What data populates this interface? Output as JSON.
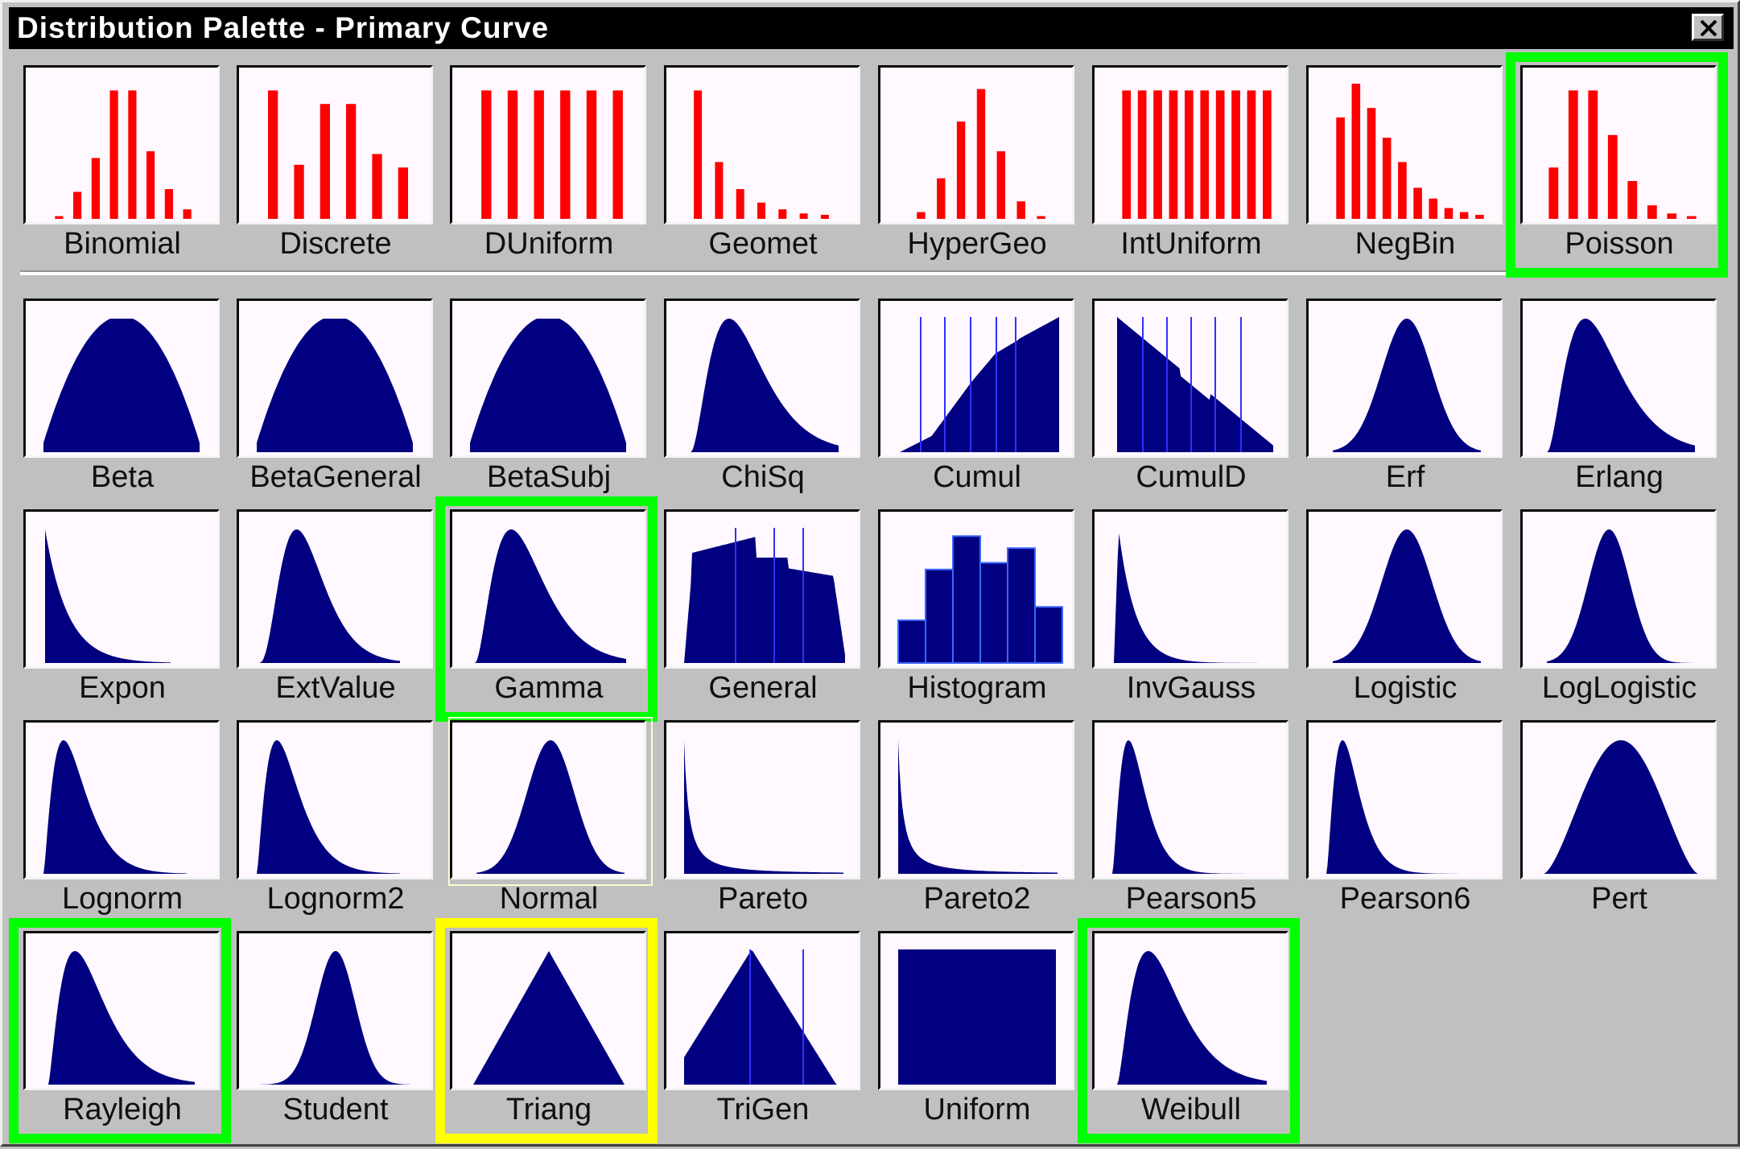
{
  "window": {
    "title": "Distribution Palette - Primary Curve",
    "close_icon": "close-icon"
  },
  "colors": {
    "discrete_bars": "#ff0000",
    "continuous_fill": "#000080",
    "tile_bg": "#fff8ff",
    "highlight_green": "#00ff00",
    "highlight_yellow": "#ffff00"
  },
  "rows": [
    {
      "kind": "discrete",
      "items": [
        {
          "label": "Binomial",
          "shape": "binomial"
        },
        {
          "label": "Discrete",
          "shape": "discrete"
        },
        {
          "label": "DUniform",
          "shape": "duniform"
        },
        {
          "label": "Geomet",
          "shape": "geomet"
        },
        {
          "label": "HyperGeo",
          "shape": "hypergeo"
        },
        {
          "label": "IntUniform",
          "shape": "intuniform"
        },
        {
          "label": "NegBin",
          "shape": "negbin"
        },
        {
          "label": "Poisson",
          "shape": "poisson",
          "highlight": "green"
        }
      ]
    },
    {
      "kind": "continuous",
      "items": [
        {
          "label": "Beta",
          "shape": "arch"
        },
        {
          "label": "BetaGeneral",
          "shape": "arch"
        },
        {
          "label": "BetaSubj",
          "shape": "arch"
        },
        {
          "label": "ChiSq",
          "shape": "skew"
        },
        {
          "label": "Cumul",
          "shape": "cumul"
        },
        {
          "label": "CumulD",
          "shape": "cumuld"
        },
        {
          "label": "Erf",
          "shape": "bell"
        },
        {
          "label": "Erlang",
          "shape": "skew"
        }
      ]
    },
    {
      "kind": "continuous",
      "items": [
        {
          "label": "Expon",
          "shape": "expon"
        },
        {
          "label": "ExtValue",
          "shape": "extvalue"
        },
        {
          "label": "Gamma",
          "shape": "gamma",
          "highlight": "green"
        },
        {
          "label": "General",
          "shape": "general"
        },
        {
          "label": "Histogram",
          "shape": "histogram"
        },
        {
          "label": "InvGauss",
          "shape": "invgauss"
        },
        {
          "label": "Logistic",
          "shape": "bell"
        },
        {
          "label": "LogLogistic",
          "shape": "narrowbell"
        }
      ]
    },
    {
      "kind": "continuous",
      "items": [
        {
          "label": "Lognorm",
          "shape": "lognorm"
        },
        {
          "label": "Lognorm2",
          "shape": "lognorm"
        },
        {
          "label": "Normal",
          "shape": "normal",
          "highlight": "faint"
        },
        {
          "label": "Pareto",
          "shape": "pareto"
        },
        {
          "label": "Pareto2",
          "shape": "pareto"
        },
        {
          "label": "Pearson5",
          "shape": "pearson"
        },
        {
          "label": "Pearson6",
          "shape": "pearson"
        },
        {
          "label": "Pert",
          "shape": "pert"
        }
      ]
    },
    {
      "kind": "continuous",
      "items": [
        {
          "label": "Rayleigh",
          "shape": "rayleigh",
          "highlight": "green"
        },
        {
          "label": "Student",
          "shape": "student"
        },
        {
          "label": "Triang",
          "shape": "triang",
          "highlight": "yellow"
        },
        {
          "label": "TriGen",
          "shape": "trigen"
        },
        {
          "label": "Uniform",
          "shape": "uniform"
        },
        {
          "label": "Weibull",
          "shape": "weibull",
          "highlight": "green"
        }
      ]
    }
  ]
}
